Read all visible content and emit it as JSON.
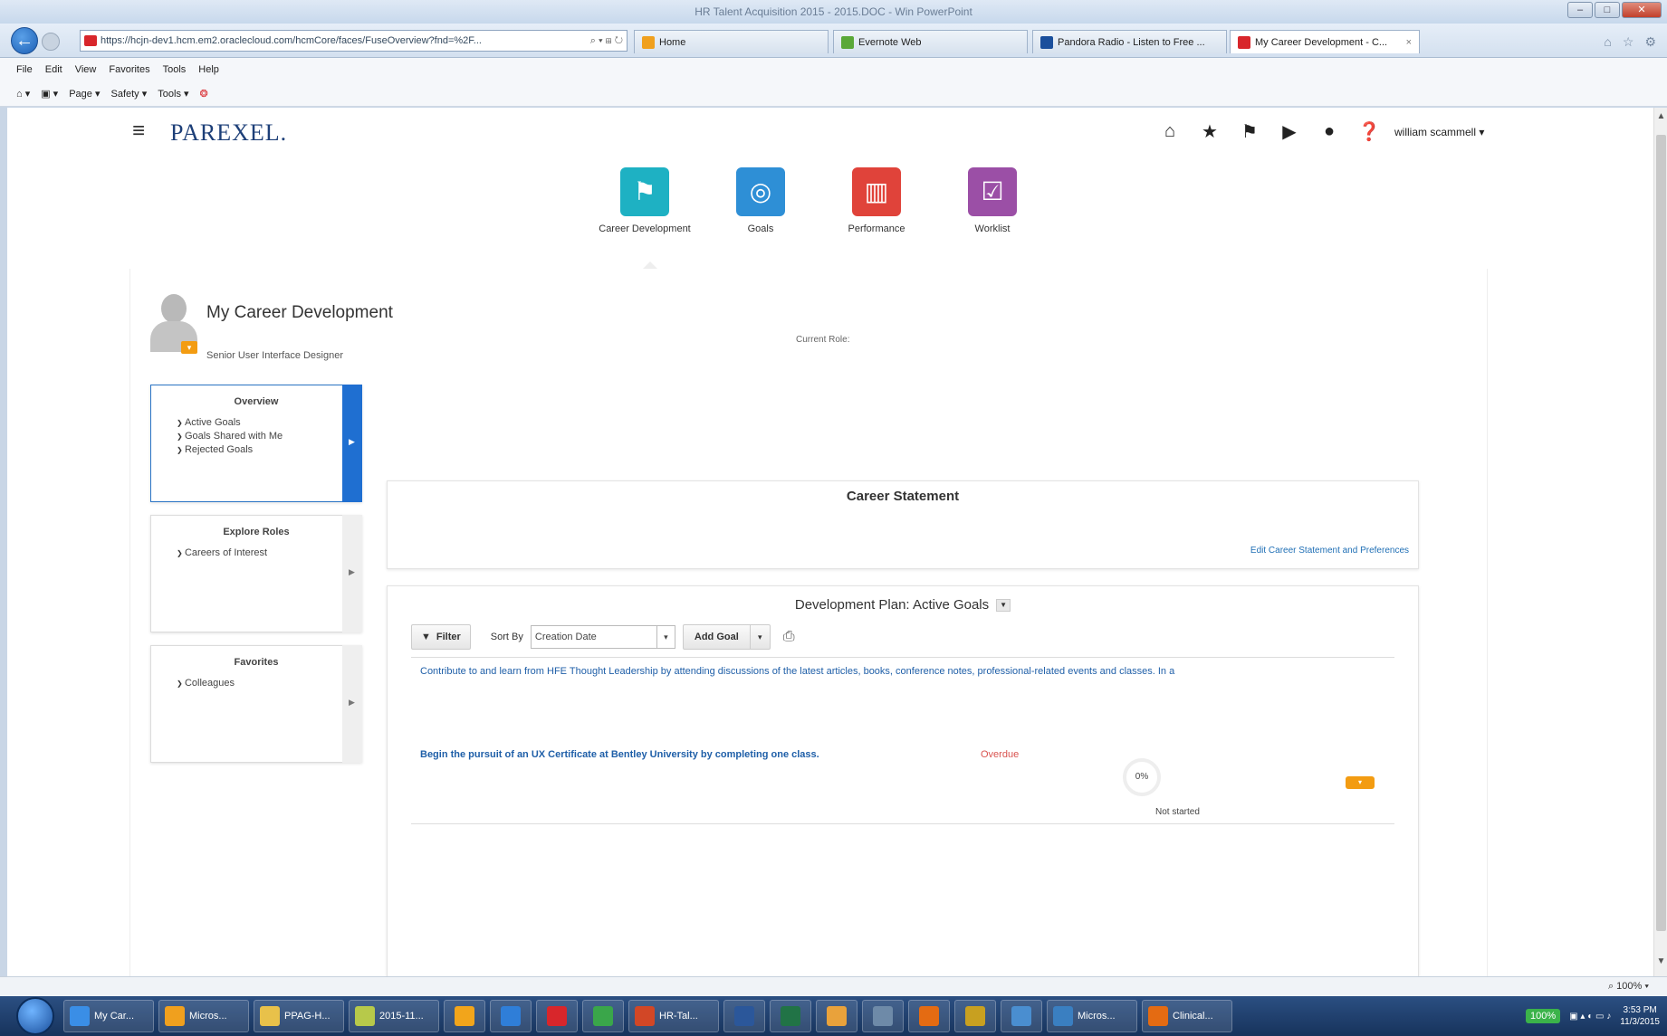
{
  "browser": {
    "window_title": "HR Talent Acquisition 2015 - 2015.DOC - Win  PowerPoint",
    "address": "https://hcjn-dev1.hcm.em2.oraclecloud.com/hcmCore/faces/FuseOverview?fnd=%2F...",
    "tabs": [
      {
        "label": "Home",
        "color": "#f0a01e"
      },
      {
        "label": "Evernote Web",
        "color": "#5aa838"
      },
      {
        "label": "Pandora Radio - Listen to Free ...",
        "color": "#1a4f9c"
      },
      {
        "label": "My Career Development - C...",
        "color": "#d8262b"
      }
    ],
    "menu": [
      "File",
      "Edit",
      "View",
      "Favorites",
      "Tools",
      "Help"
    ],
    "command_bar": [
      "Page ▾",
      "Safety ▾",
      "Tools ▾"
    ],
    "zoom": "100%"
  },
  "app": {
    "logo": "PAREXEL.",
    "user_name": "william scammell ▾",
    "header_icons": [
      "home-icon",
      "favorites-star-icon",
      "navigator-flag-icon",
      "notifications-icon",
      "accessibility-icon",
      "help-icon"
    ],
    "springboard": [
      {
        "label": "Career Development",
        "color": "#1eb1c3",
        "glyph": "⚑"
      },
      {
        "label": "Goals",
        "color": "#2e8fd6",
        "glyph": "◎"
      },
      {
        "label": "Performance",
        "color": "#e0433a",
        "glyph": "▥"
      },
      {
        "label": "Worklist",
        "color": "#9b4fa6",
        "glyph": "☑"
      }
    ]
  },
  "profile": {
    "title": "My Career Development",
    "job_title": "Senior User Interface Designer",
    "current_role_label": "Current Role:"
  },
  "side_cards": [
    {
      "heading": "Overview",
      "links": [
        "Active Goals",
        "Goals Shared with Me",
        "Rejected Goals"
      ]
    },
    {
      "heading": "Explore Roles",
      "links": [
        "Careers of Interest"
      ]
    },
    {
      "heading": "Favorites",
      "links": [
        "Colleagues"
      ]
    }
  ],
  "career_statement": {
    "title": "Career Statement",
    "edit_link": "Edit Career Statement and Preferences"
  },
  "development_plan": {
    "title": "Development Plan: Active Goals",
    "filter_label": "Filter",
    "sort_label": "Sort By",
    "sort_value": "Creation Date",
    "add_goal_label": "Add Goal",
    "goals": [
      {
        "text": "Contribute to and learn from HFE Thought Leadership by attending discussions of the latest articles, books, conference notes, professional-related events and classes. In a"
      },
      {
        "text": "Begin the pursuit of an UX Certificate at Bentley University by completing one class.",
        "flag": "Overdue",
        "progress": "0%",
        "status": "Not started"
      }
    ]
  },
  "taskbar": {
    "items": [
      {
        "label": "My Car...",
        "color": "#3a8ee6"
      },
      {
        "label": "Micros...",
        "color": "#f0a01e"
      },
      {
        "label": "PPAG-H...",
        "color": "#e8c14a"
      },
      {
        "label": "2015-11...",
        "color": "#b7c94a"
      },
      {
        "label": "",
        "color": "#f2a51b"
      },
      {
        "label": "",
        "color": "#2f7ed8"
      },
      {
        "label": "",
        "color": "#d8262b"
      },
      {
        "label": "",
        "color": "#3aa64a"
      },
      {
        "label": "HR-Tal...",
        "color": "#d24726"
      },
      {
        "label": "",
        "color": "#2b579a"
      },
      {
        "label": "",
        "color": "#217346"
      },
      {
        "label": "",
        "color": "#e9a23b"
      },
      {
        "label": "",
        "color": "#6e8aa8"
      },
      {
        "label": "",
        "color": "#e46b12"
      },
      {
        "label": "",
        "color": "#c8a020"
      },
      {
        "label": "",
        "color": "#4a8ed0"
      },
      {
        "label": "Micros...",
        "color": "#3a7fc1"
      },
      {
        "label": "Clinical...",
        "color": "#e46b12"
      }
    ],
    "tray_percent": "100%",
    "time": "3:53 PM",
    "date": "11/3/2015"
  }
}
